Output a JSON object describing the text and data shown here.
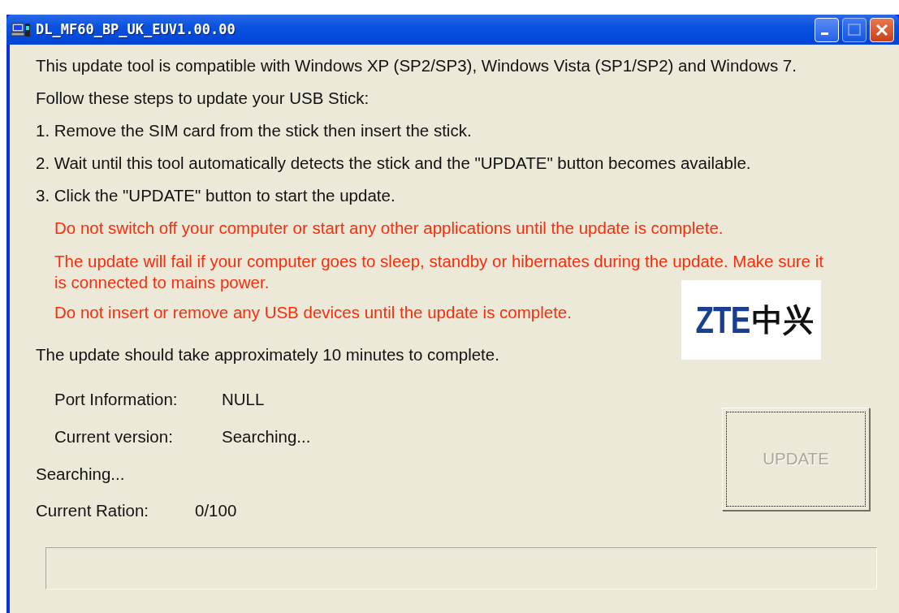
{
  "window": {
    "title": "DL_MF60_BP_UK_EUV1.00.00"
  },
  "intro": [
    "This update tool is compatible with Windows XP (SP2/SP3), Windows Vista (SP1/SP2) and Windows 7.",
    "Follow these steps to update your USB Stick:",
    "1. Remove the SIM card from the stick then insert the stick.",
    "2. Wait until this tool automatically detects the stick and the \"UPDATE\" button becomes available.",
    "3. Click the \"UPDATE\" button to start the update."
  ],
  "warnings": [
    "Do not switch off your computer or start any other applications until the update is complete.",
    "The update will fail if your computer goes to sleep, standby or hibernates during the update. Make sure it is connected to mains power.",
    "Do not insert or remove any USB devices until the update is complete."
  ],
  "logo": {
    "latin": "ZTE",
    "chinese": "中兴"
  },
  "duration_note": "The update should take approximately 10 minutes to complete.",
  "info": [
    {
      "label": "Port Information:",
      "value": "NULL"
    },
    {
      "label": "Current version:",
      "value": "Searching..."
    }
  ],
  "status": "Searching...",
  "ration": {
    "label": "Current Ration:",
    "value": "0/100"
  },
  "update_button": {
    "label": "UPDATE",
    "disabled": true
  },
  "progress": {
    "level": 0
  }
}
